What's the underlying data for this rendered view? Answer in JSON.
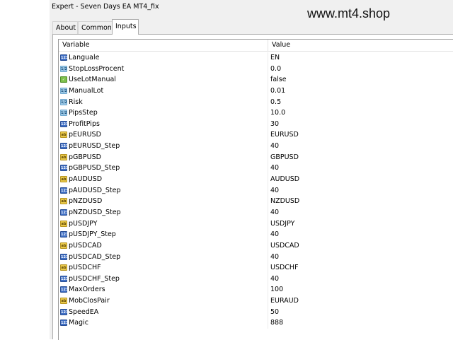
{
  "window": {
    "title": "Expert - Seven Days EA MT4_fix"
  },
  "watermark": "www.mt4.shop",
  "tabs": [
    {
      "label": "About"
    },
    {
      "label": "Common"
    },
    {
      "label": "Inputs",
      "active": true
    }
  ],
  "table": {
    "columns": {
      "variable": "Variable",
      "value": "Value"
    },
    "rows": [
      {
        "icon": "int-type-icon",
        "name": "Languale",
        "value": "EN"
      },
      {
        "icon": "double-type-icon",
        "name": "StopLossProcent",
        "value": "0.0"
      },
      {
        "icon": "bool-type-icon",
        "name": "UseLotManual",
        "value": "false"
      },
      {
        "icon": "double-type-icon",
        "name": "ManualLot",
        "value": "0.01"
      },
      {
        "icon": "double-type-icon",
        "name": "Risk",
        "value": "0.5"
      },
      {
        "icon": "double-type-icon",
        "name": "PipsStep",
        "value": "10.0"
      },
      {
        "icon": "int-type-icon",
        "name": "ProfitPips",
        "value": "30"
      },
      {
        "icon": "string-type-icon",
        "name": "pEURUSD",
        "value": "EURUSD"
      },
      {
        "icon": "int-type-icon",
        "name": "pEURUSD_Step",
        "value": "40"
      },
      {
        "icon": "string-type-icon",
        "name": "pGBPUSD",
        "value": "GBPUSD"
      },
      {
        "icon": "int-type-icon",
        "name": "pGBPUSD_Step",
        "value": "40"
      },
      {
        "icon": "string-type-icon",
        "name": "pAUDUSD",
        "value": "AUDUSD"
      },
      {
        "icon": "int-type-icon",
        "name": "pAUDUSD_Step",
        "value": "40"
      },
      {
        "icon": "string-type-icon",
        "name": "pNZDUSD",
        "value": "NZDUSD"
      },
      {
        "icon": "int-type-icon",
        "name": "pNZDUSD_Step",
        "value": "40"
      },
      {
        "icon": "string-type-icon",
        "name": "pUSDJPY",
        "value": "USDJPY"
      },
      {
        "icon": "int-type-icon",
        "name": "pUSDJPY_Step",
        "value": "40"
      },
      {
        "icon": "string-type-icon",
        "name": "pUSDCAD",
        "value": "USDCAD"
      },
      {
        "icon": "int-type-icon",
        "name": "pUSDCAD_Step",
        "value": "40"
      },
      {
        "icon": "string-type-icon",
        "name": "pUSDCHF",
        "value": "USDCHF"
      },
      {
        "icon": "int-type-icon",
        "name": "pUSDCHF_Step",
        "value": "40"
      },
      {
        "icon": "int-type-icon",
        "name": "MaxOrders",
        "value": "100"
      },
      {
        "icon": "string-type-icon",
        "name": "MobClosPair",
        "value": "EURAUD"
      },
      {
        "icon": "int-type-icon",
        "name": "SpeedEA",
        "value": "50"
      },
      {
        "icon": "int-type-icon",
        "name": "Magic",
        "value": "888"
      }
    ]
  },
  "colors": {
    "int_icon": "#3f6fc4",
    "double_icon": "#9fcbe8",
    "bool_icon": "#7cbf4a",
    "string_icon": "#e9c94a",
    "dialog_background": "#f0f0f0"
  }
}
